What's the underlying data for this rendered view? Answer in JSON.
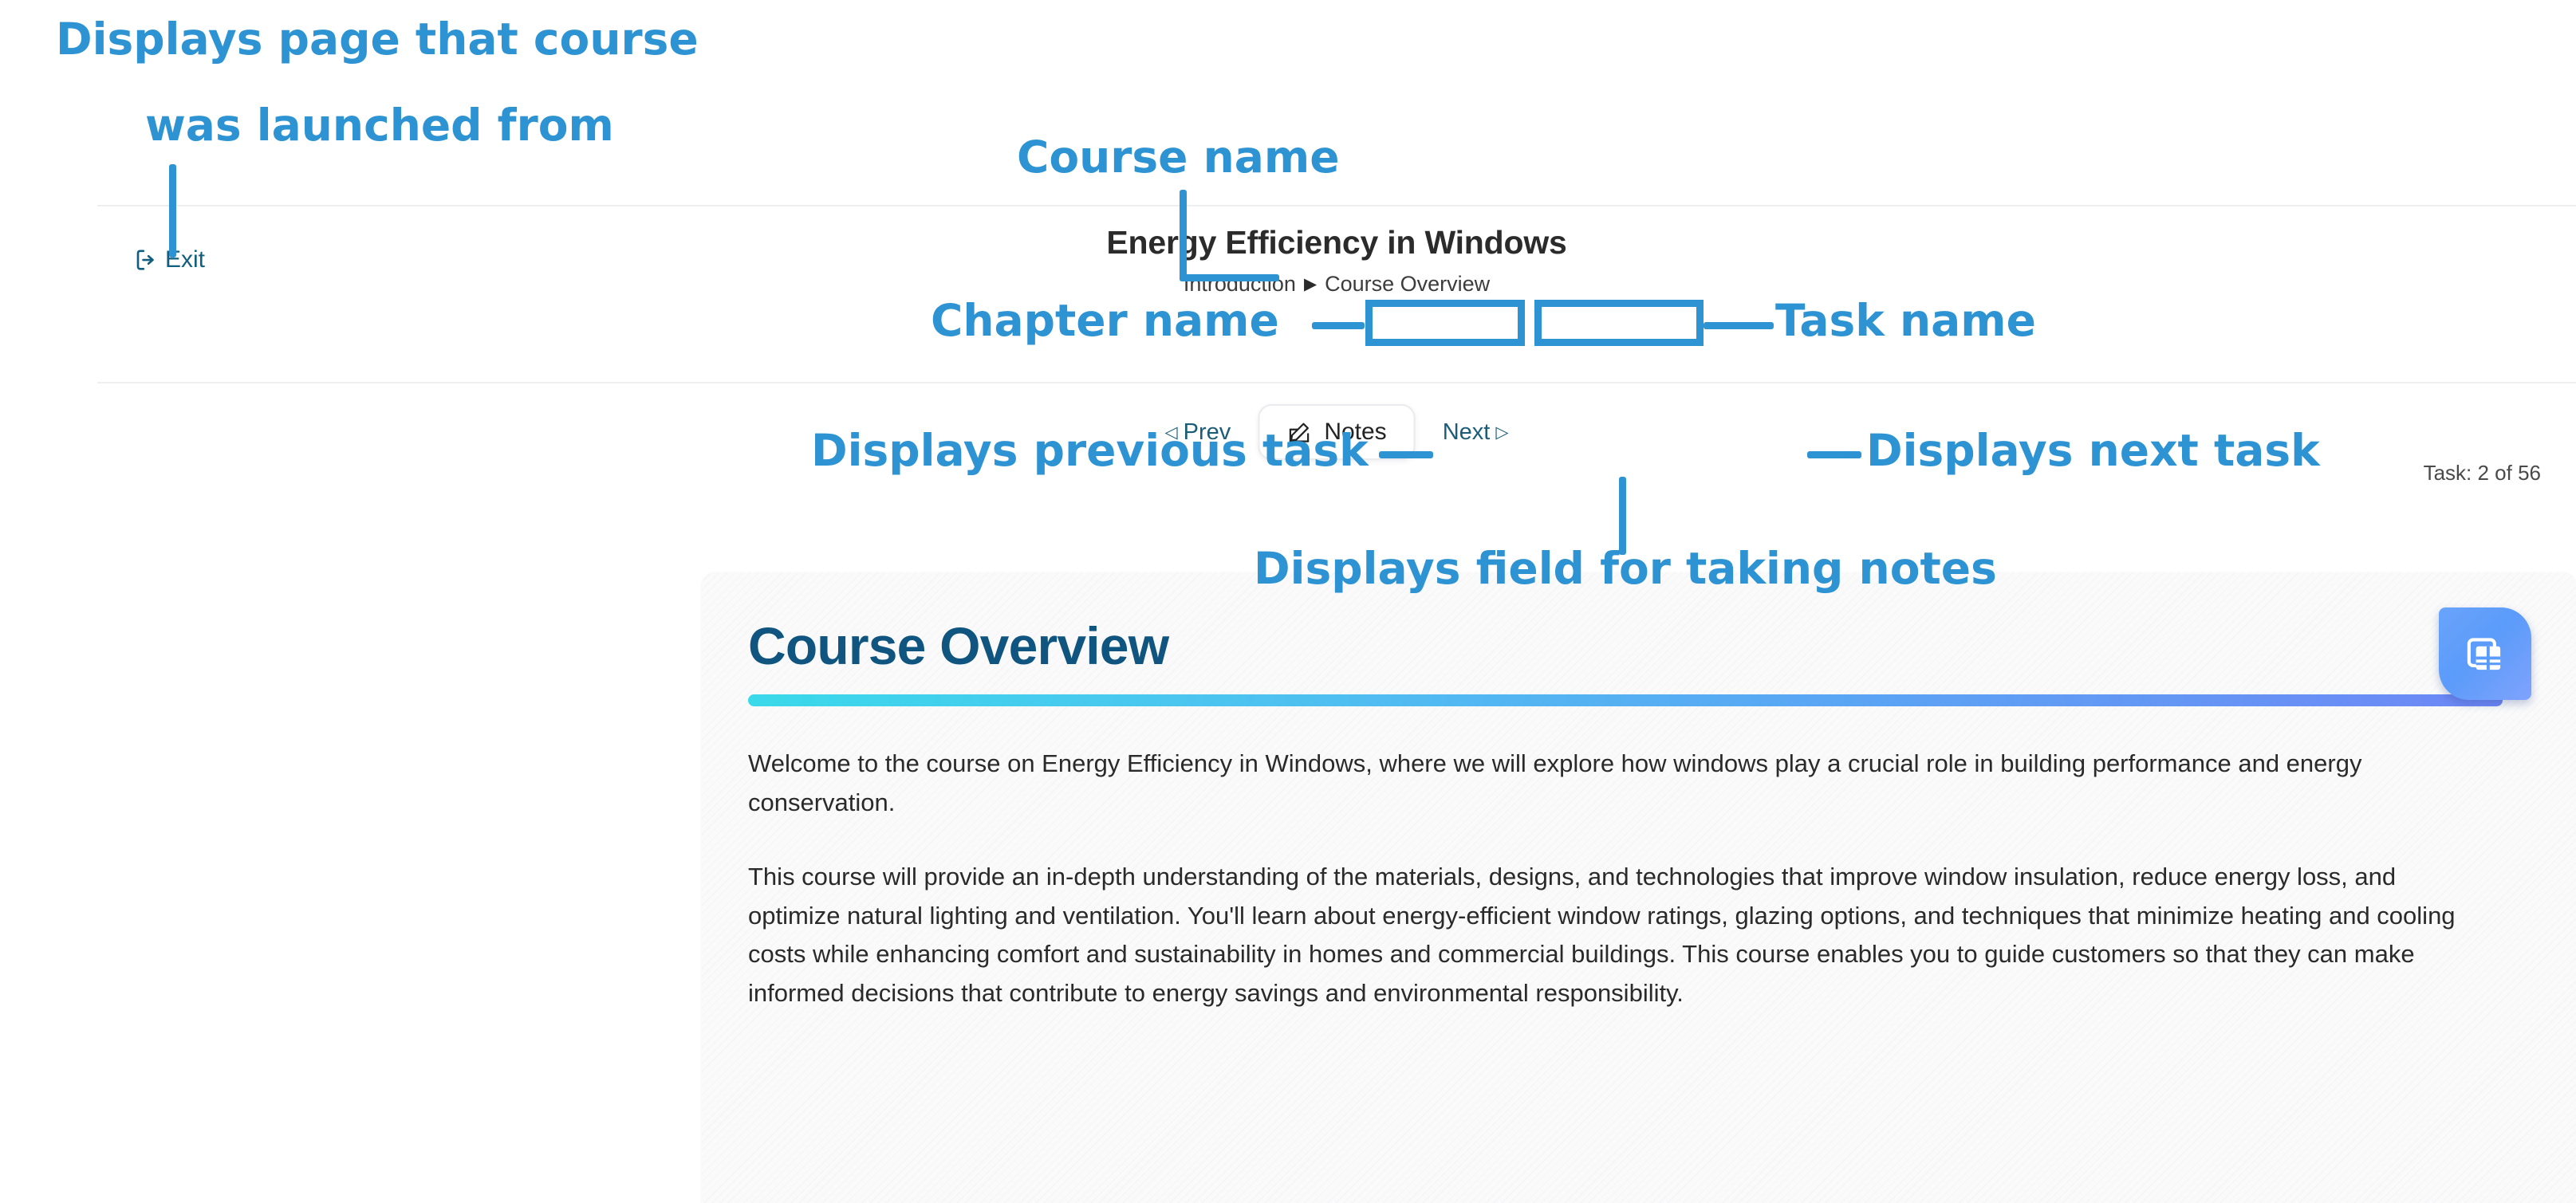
{
  "app": {
    "exit_label": "Exit",
    "course_title": "Energy Efficiency in Windows",
    "breadcrumb": {
      "chapter": "Introduction",
      "separator": "▶",
      "task": "Course Overview"
    },
    "nav": {
      "prev_label": "Prev",
      "prev_glyph": "◁",
      "notes_label": "Notes",
      "next_label": "Next",
      "next_glyph": "▷"
    },
    "task_counter": "Task: 2 of 56"
  },
  "card": {
    "title": "Course Overview",
    "paragraphs": [
      "Welcome to the course on Energy Efficiency in Windows, where we will explore how windows play a crucial role in building performance and energy conservation.",
      "This course will provide an in-depth understanding of the materials, designs, and technologies that improve window insulation, reduce energy loss, and optimize natural lighting and ventilation. You'll learn about energy-efficient window ratings, glazing options, and techniques that minimize heating and cooling costs while enhancing comfort and sustainability in homes and commercial buildings. This course enables you to guide customers so that they can make informed decisions that contribute to energy savings and environmental responsibility."
    ]
  },
  "annotations": {
    "exit_line1": "Displays page that course",
    "exit_line2": "was launched from",
    "course_name": "Course name",
    "chapter_name": "Chapter name",
    "task_name": "Task name",
    "prev": "Displays previous task",
    "next": "Displays next task",
    "notes": "Displays field for taking notes"
  },
  "colors": {
    "annotation_blue": "#2d93d2",
    "card_title_blue": "#0f557f",
    "exit_teal": "#115e7e",
    "nav_link_blue": "#1b5d78",
    "rule_gradient_start": "#3ad9ea",
    "rule_gradient_end": "#6e87f5"
  }
}
